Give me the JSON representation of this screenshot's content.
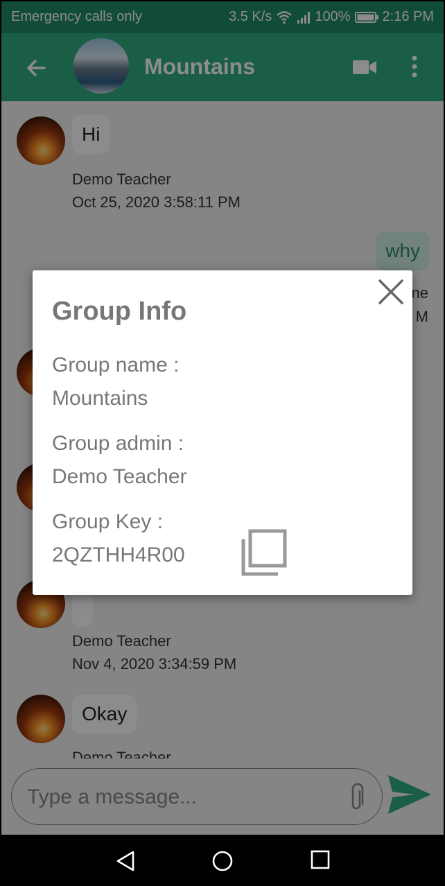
{
  "status_bar": {
    "carrier": "Emergency calls only",
    "speed": "3.5 K/s",
    "battery": "100%",
    "time": "2:16 PM"
  },
  "app_bar": {
    "title": "Mountains",
    "icons": [
      "back-arrow-icon",
      "video-call-icon",
      "more-vert-icon"
    ]
  },
  "messages": [
    {
      "text": "Hi",
      "sender": "Demo Teacher",
      "timestamp": "Oct 25, 2020 3:58:11 PM",
      "direction": "incoming"
    },
    {
      "text": "why",
      "sender_fragment": "ne",
      "timestamp_fragment": "M",
      "direction": "outgoing"
    },
    {
      "text": "",
      "direction": "incoming"
    },
    {
      "text": "",
      "direction": "incoming"
    },
    {
      "text": "",
      "sender": "Demo Teacher",
      "timestamp": "Nov 4, 2020 3:34:59 PM",
      "direction": "incoming"
    },
    {
      "text": "Okay",
      "sender": "Demo Teacher",
      "direction": "incoming"
    }
  ],
  "input": {
    "placeholder": "Type a message..."
  },
  "dialog": {
    "title": "Group Info",
    "group_name_label": "Group name :",
    "group_name": "Mountains",
    "group_admin_label": "Group admin :",
    "group_admin": "Demo Teacher",
    "group_key_label": "Group Key :",
    "group_key": "2QZTHH4R00"
  },
  "colors": {
    "primary": "#2eac7e",
    "primary_dark": "#1e8a63",
    "dialog_text": "#777777"
  }
}
